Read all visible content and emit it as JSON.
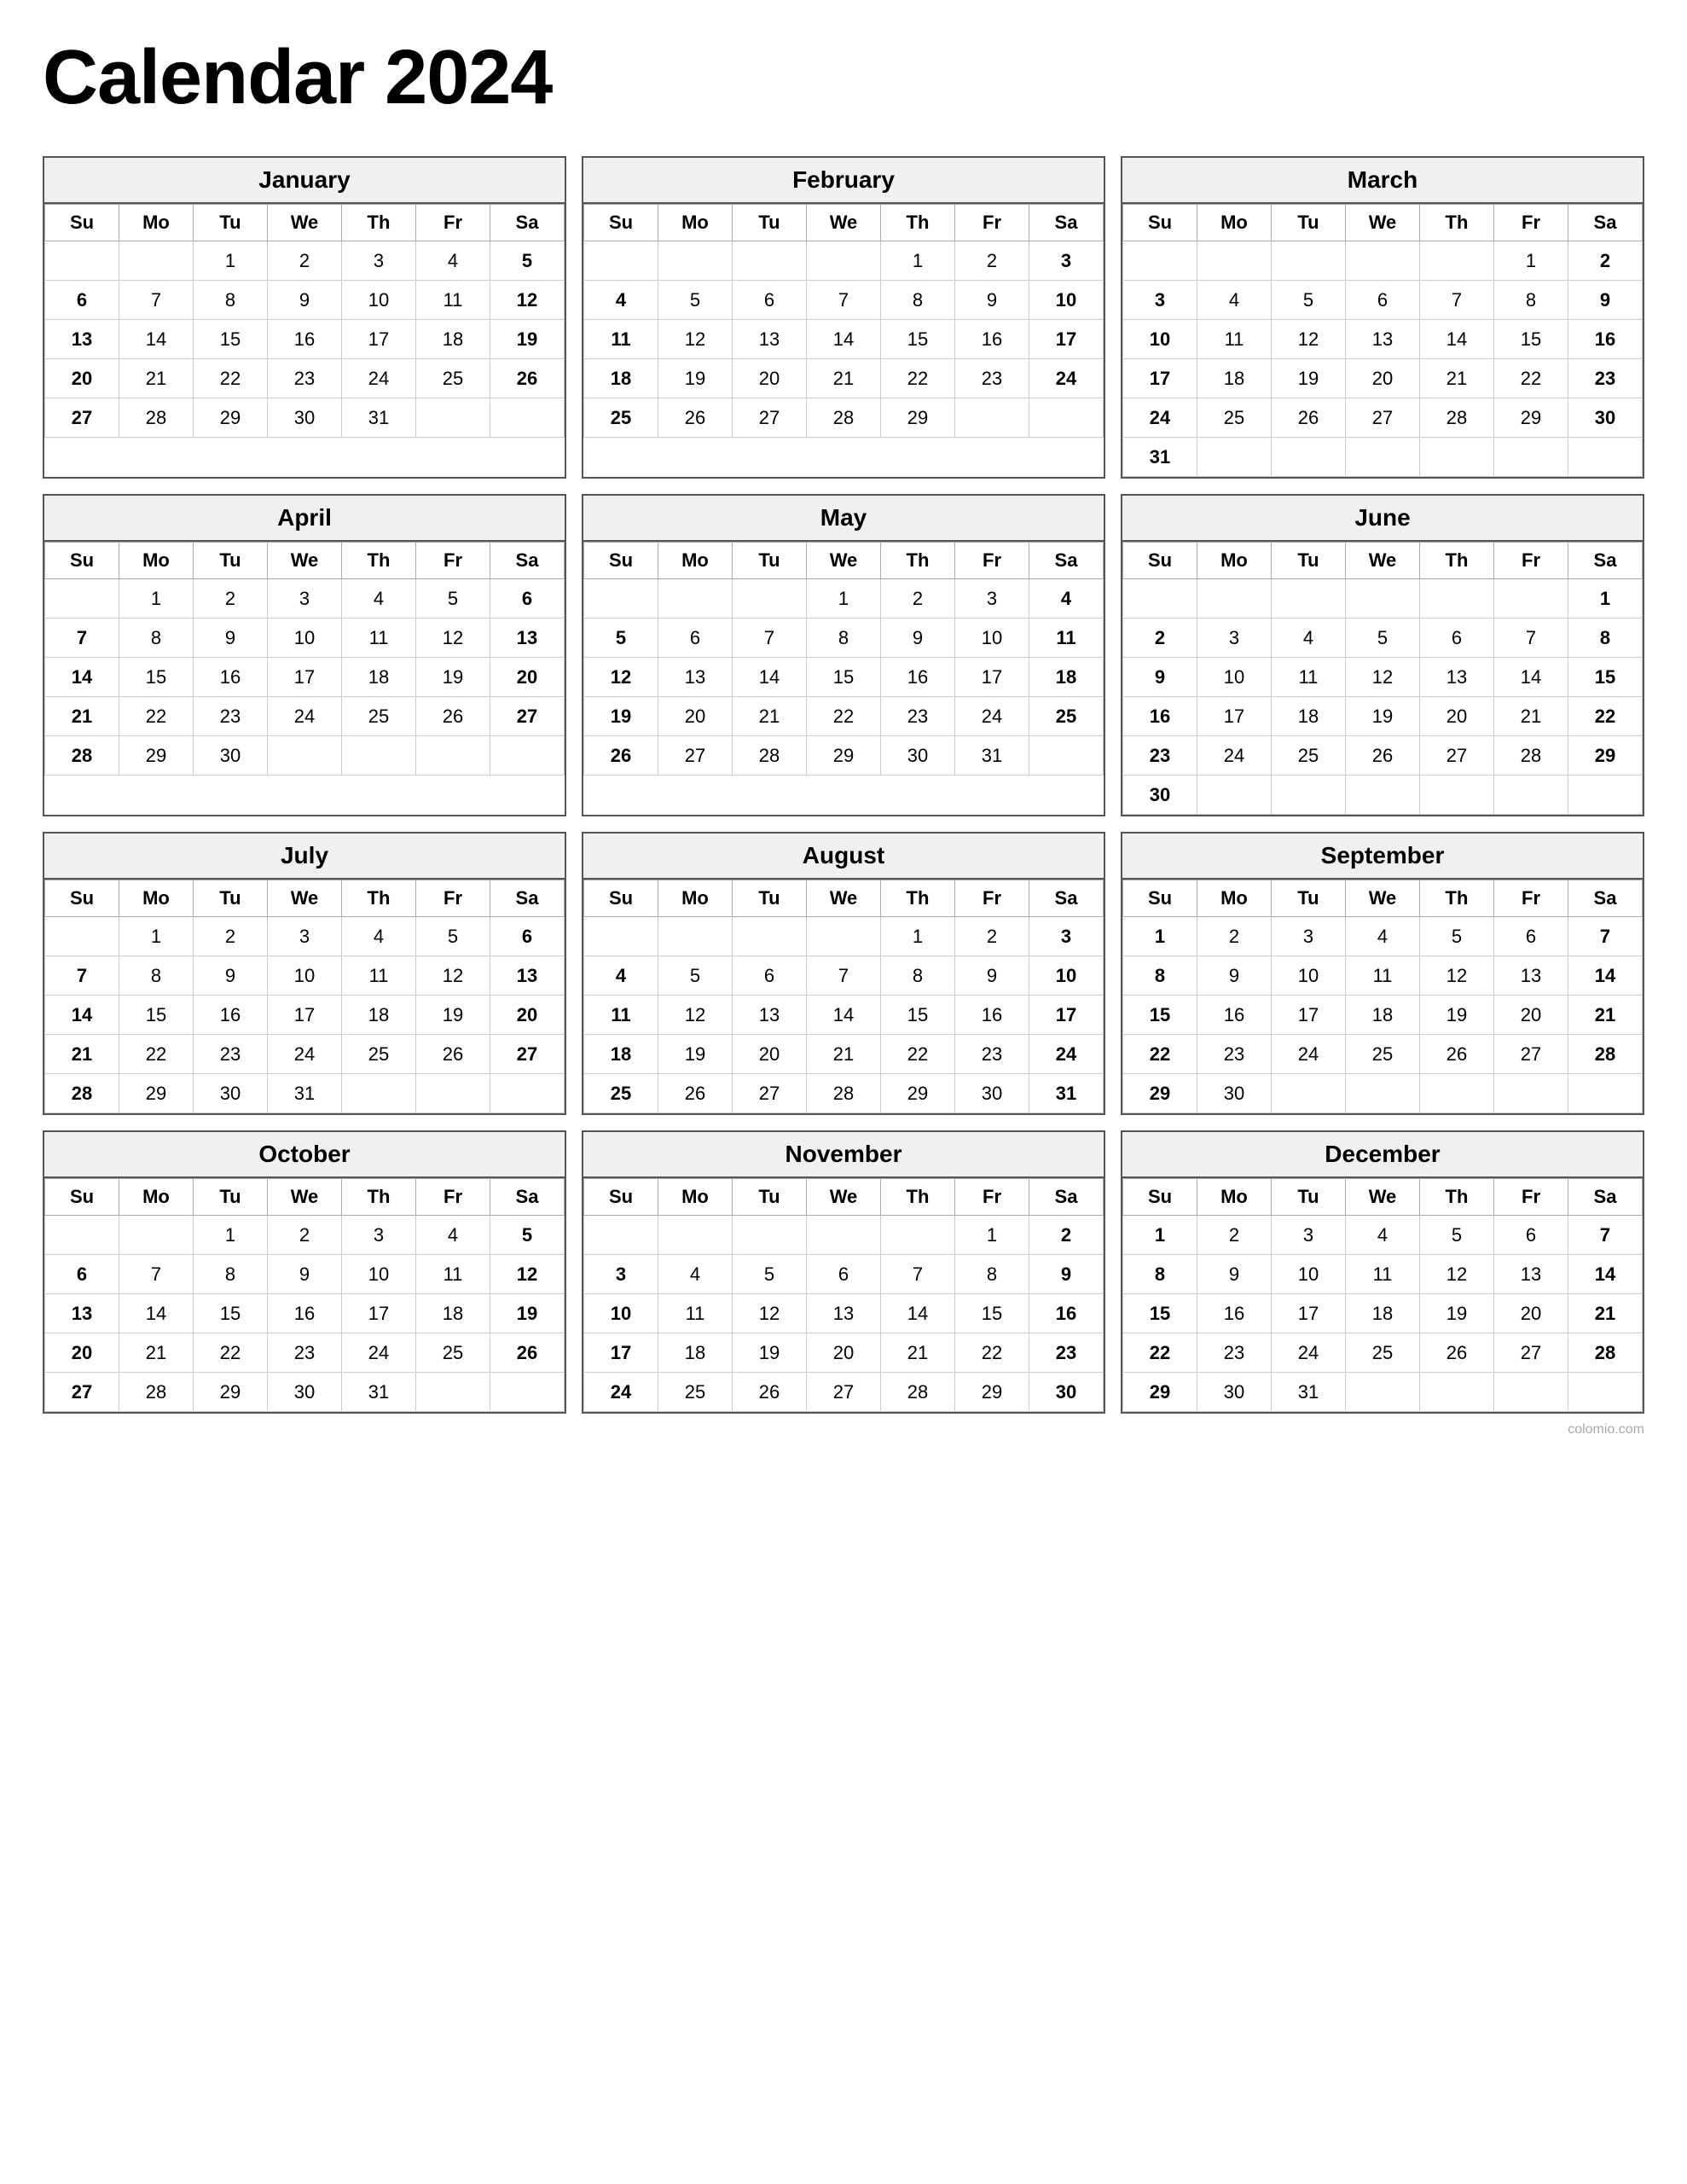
{
  "title": "Calendar 2024",
  "months": [
    {
      "name": "January",
      "weeks": [
        [
          "",
          "",
          "1",
          "2",
          "3",
          "4",
          "5"
        ],
        [
          "6",
          "7",
          "8",
          "9",
          "10",
          "11",
          "12"
        ],
        [
          "13",
          "14",
          "15",
          "16",
          "17",
          "18",
          "19"
        ],
        [
          "20",
          "21",
          "22",
          "23",
          "24",
          "25",
          "26"
        ],
        [
          "27",
          "28",
          "29",
          "30",
          "31",
          "",
          ""
        ]
      ],
      "saturdayBolds": [
        6,
        13,
        20,
        27
      ],
      "sundayBolds": [
        6,
        13,
        20,
        27
      ]
    },
    {
      "name": "February",
      "weeks": [
        [
          "",
          "",
          "",
          "",
          "1",
          "2",
          "3"
        ],
        [
          "4",
          "5",
          "6",
          "7",
          "8",
          "9",
          "10"
        ],
        [
          "11",
          "12",
          "13",
          "14",
          "15",
          "16",
          "17"
        ],
        [
          "18",
          "19",
          "20",
          "21",
          "22",
          "23",
          "24"
        ],
        [
          "25",
          "26",
          "27",
          "28",
          "29",
          "",
          ""
        ]
      ]
    },
    {
      "name": "March",
      "weeks": [
        [
          "",
          "",
          "",
          "",
          "",
          "1",
          "2"
        ],
        [
          "3",
          "4",
          "5",
          "6",
          "7",
          "8",
          "9"
        ],
        [
          "10",
          "11",
          "12",
          "13",
          "14",
          "15",
          "16"
        ],
        [
          "17",
          "18",
          "19",
          "20",
          "21",
          "22",
          "23"
        ],
        [
          "24",
          "25",
          "26",
          "27",
          "28",
          "29",
          "30"
        ],
        [
          "31",
          "",
          "",
          "",
          "",
          "",
          ""
        ]
      ]
    },
    {
      "name": "April",
      "weeks": [
        [
          "",
          "1",
          "2",
          "3",
          "4",
          "5",
          "6"
        ],
        [
          "7",
          "8",
          "9",
          "10",
          "11",
          "12",
          "13"
        ],
        [
          "14",
          "15",
          "16",
          "17",
          "18",
          "19",
          "20"
        ],
        [
          "21",
          "22",
          "23",
          "24",
          "25",
          "26",
          "27"
        ],
        [
          "28",
          "29",
          "30",
          "",
          "",
          "",
          ""
        ]
      ]
    },
    {
      "name": "May",
      "weeks": [
        [
          "",
          "",
          "",
          "1",
          "2",
          "3",
          "4"
        ],
        [
          "5",
          "6",
          "7",
          "8",
          "9",
          "10",
          "11"
        ],
        [
          "12",
          "13",
          "14",
          "15",
          "16",
          "17",
          "18"
        ],
        [
          "19",
          "20",
          "21",
          "22",
          "23",
          "24",
          "25"
        ],
        [
          "26",
          "27",
          "28",
          "29",
          "30",
          "31",
          ""
        ]
      ]
    },
    {
      "name": "June",
      "weeks": [
        [
          "",
          "",
          "",
          "",
          "",
          "",
          "1"
        ],
        [
          "2",
          "3",
          "4",
          "5",
          "6",
          "7",
          "8"
        ],
        [
          "9",
          "10",
          "11",
          "12",
          "13",
          "14",
          "15"
        ],
        [
          "16",
          "17",
          "18",
          "19",
          "20",
          "21",
          "22"
        ],
        [
          "23",
          "24",
          "25",
          "26",
          "27",
          "28",
          "29"
        ],
        [
          "30",
          "",
          "",
          "",
          "",
          "",
          ""
        ]
      ]
    },
    {
      "name": "July",
      "weeks": [
        [
          "",
          "1",
          "2",
          "3",
          "4",
          "5",
          "6"
        ],
        [
          "7",
          "8",
          "9",
          "10",
          "11",
          "12",
          "13"
        ],
        [
          "14",
          "15",
          "16",
          "17",
          "18",
          "19",
          "20"
        ],
        [
          "21",
          "22",
          "23",
          "24",
          "25",
          "26",
          "27"
        ],
        [
          "28",
          "29",
          "30",
          "31",
          "",
          "",
          ""
        ]
      ]
    },
    {
      "name": "August",
      "weeks": [
        [
          "",
          "",
          "",
          "",
          "1",
          "2",
          "3"
        ],
        [
          "4",
          "5",
          "6",
          "7",
          "8",
          "9",
          "10"
        ],
        [
          "11",
          "12",
          "13",
          "14",
          "15",
          "16",
          "17"
        ],
        [
          "18",
          "19",
          "20",
          "21",
          "22",
          "23",
          "24"
        ],
        [
          "25",
          "26",
          "27",
          "28",
          "29",
          "30",
          "31"
        ]
      ]
    },
    {
      "name": "September",
      "weeks": [
        [
          "1",
          "2",
          "3",
          "4",
          "5",
          "6",
          "7"
        ],
        [
          "8",
          "9",
          "10",
          "11",
          "12",
          "13",
          "14"
        ],
        [
          "15",
          "16",
          "17",
          "18",
          "19",
          "20",
          "21"
        ],
        [
          "22",
          "23",
          "24",
          "25",
          "26",
          "27",
          "28"
        ],
        [
          "29",
          "30",
          "",
          "",
          "",
          "",
          ""
        ]
      ]
    },
    {
      "name": "October",
      "weeks": [
        [
          "",
          "",
          "1",
          "2",
          "3",
          "4",
          "5"
        ],
        [
          "6",
          "7",
          "8",
          "9",
          "10",
          "11",
          "12"
        ],
        [
          "13",
          "14",
          "15",
          "16",
          "17",
          "18",
          "19"
        ],
        [
          "20",
          "21",
          "22",
          "23",
          "24",
          "25",
          "26"
        ],
        [
          "27",
          "28",
          "29",
          "30",
          "31",
          "",
          ""
        ]
      ]
    },
    {
      "name": "November",
      "weeks": [
        [
          "",
          "",
          "",
          "",
          "",
          "1",
          "2"
        ],
        [
          "3",
          "4",
          "5",
          "6",
          "7",
          "8",
          "9"
        ],
        [
          "10",
          "11",
          "12",
          "13",
          "14",
          "15",
          "16"
        ],
        [
          "17",
          "18",
          "19",
          "20",
          "21",
          "22",
          "23"
        ],
        [
          "24",
          "25",
          "26",
          "27",
          "28",
          "29",
          "30"
        ]
      ]
    },
    {
      "name": "December",
      "weeks": [
        [
          "1",
          "2",
          "3",
          "4",
          "5",
          "6",
          "7"
        ],
        [
          "8",
          "9",
          "10",
          "11",
          "12",
          "13",
          "14"
        ],
        [
          "15",
          "16",
          "17",
          "18",
          "19",
          "20",
          "21"
        ],
        [
          "22",
          "23",
          "24",
          "25",
          "26",
          "27",
          "28"
        ],
        [
          "29",
          "30",
          "31",
          "",
          "",
          "",
          ""
        ]
      ]
    }
  ],
  "days": [
    "Su",
    "Mo",
    "Tu",
    "We",
    "Th",
    "Fr",
    "Sa"
  ],
  "watermark": "colomio.com"
}
